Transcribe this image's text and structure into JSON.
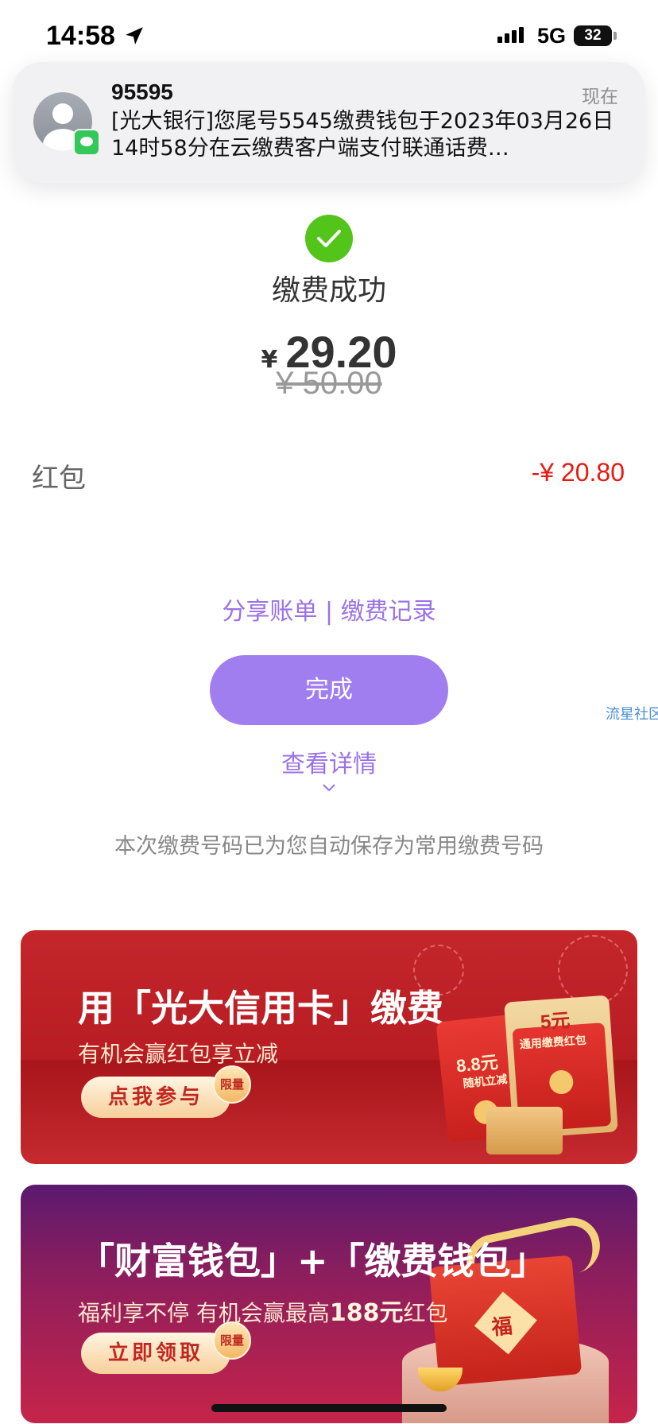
{
  "status_bar": {
    "time": "14:58",
    "network": "5G",
    "battery": "32"
  },
  "notification": {
    "sender": "95595",
    "time": "现在",
    "body": "[光大银行]您尾号5545缴费钱包于2023年03月26日14时58分在云缴费客户端支付联通话费…",
    "app_icon": "messages-icon"
  },
  "payment": {
    "status": "缴费成功",
    "currency": "¥",
    "amount": "29.20",
    "original_amount": "¥ 50.00",
    "discount_label": "红包",
    "discount_value": "-¥ 20.80"
  },
  "actions": {
    "share_bill": "分享账单",
    "separator": " | ",
    "payment_records": "缴费记录",
    "done": "完成",
    "view_details": "查看详情"
  },
  "side_tag": "流星社区",
  "saved_note": "本次缴费号码已为您自动保存为常用缴费号码",
  "banners": [
    {
      "title": "用「光大信用卡」缴费",
      "subtitle": "有机会赢红包享立减",
      "button": "点我参与",
      "badge": "限量",
      "envelope_small_amount": "8.8元",
      "envelope_small_note": "随机立减",
      "envelope_big_amount": "5元",
      "envelope_big_note": "通用缴费红包"
    },
    {
      "title": "「财富钱包」+「缴费钱包」",
      "subtitle_pre": "福利享不停 有机会赢最高",
      "subtitle_highlight": "188元",
      "subtitle_post": "红包",
      "button": "立即领取",
      "badge": "限量",
      "box_char": "福"
    }
  ],
  "colors": {
    "success_green": "#52c41a",
    "accent_purple": "#a17ef0",
    "link_purple": "#9b72e6",
    "discount_red": "#e8190e"
  }
}
